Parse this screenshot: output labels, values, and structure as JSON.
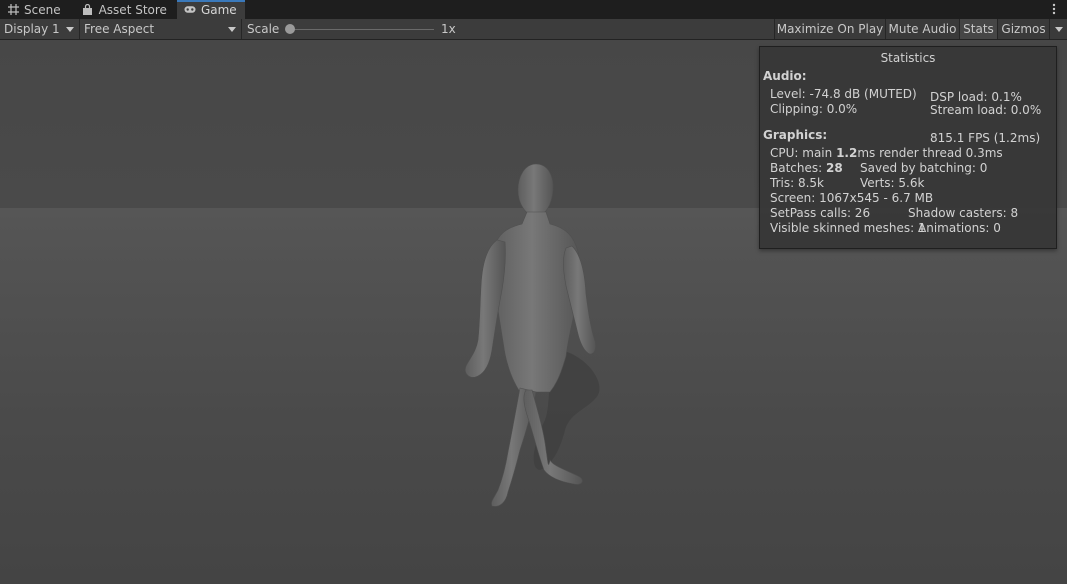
{
  "tabs": [
    {
      "label": "Scene",
      "icon": "grid-icon"
    },
    {
      "label": "Asset Store",
      "icon": "bag-icon"
    },
    {
      "label": "Game",
      "icon": "gamepad-icon",
      "active": true
    }
  ],
  "toolbar": {
    "display": "Display 1",
    "aspect": "Free Aspect",
    "scale_label": "Scale",
    "scale_value": "1x",
    "scale_level": 0.0,
    "maximize": "Maximize On Play",
    "mute": "Mute Audio",
    "stats": "Stats",
    "gizmos": "Gizmos"
  },
  "stats": {
    "title": "Statistics",
    "audio_header": "Audio:",
    "level": "Level: -74.8 dB (MUTED)",
    "clipping": "Clipping: 0.0%",
    "dsp": "DSP load: 0.1%",
    "stream": "Stream load: 0.0%",
    "graphics_header": "Graphics:",
    "fps": "815.1 FPS (1.2ms)",
    "cpu_prefix": "CPU: main ",
    "cpu_main": "1.2",
    "cpu_suffix": "ms  render thread 0.3ms",
    "batches_prefix": "Batches: ",
    "batches": "28",
    "saved": "Saved by batching: 0",
    "tris": "Tris: 8.5k",
    "verts": "Verts: 5.6k",
    "screen": "Screen: 1067x545 - 6.7 MB",
    "setpass": "SetPass calls: 26",
    "shadow": "Shadow casters: 8",
    "skinned": "Visible skinned meshes: 1",
    "animations": "Animations: 0"
  },
  "colors": {
    "tab_bar": "#1e1e1e",
    "toolbar": "#3c3c3c",
    "accent": "#3a79bb",
    "character": "#6e6e6e"
  }
}
